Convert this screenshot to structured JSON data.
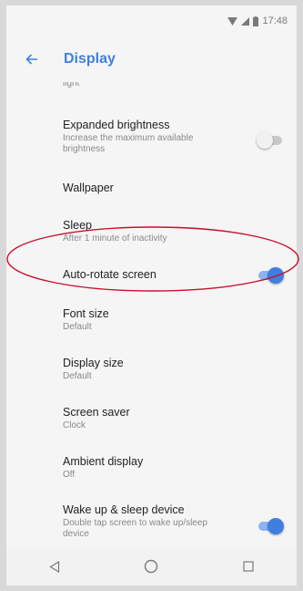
{
  "status_bar": {
    "time": "17:48"
  },
  "app_bar": {
    "title": "Display",
    "back_icon": "arrow-left-icon"
  },
  "settings": [
    {
      "title": "",
      "subtitle": "light"
    },
    {
      "title": "Expanded brightness",
      "subtitle": "Increase the maximum available brightness",
      "toggle": false
    },
    {
      "title": "Wallpaper",
      "subtitle": ""
    },
    {
      "title": "Sleep",
      "subtitle": "After 1 minute of inactivity"
    },
    {
      "title": "Auto-rotate screen",
      "subtitle": "",
      "toggle": true
    },
    {
      "title": "Font size",
      "subtitle": "Default"
    },
    {
      "title": "Display size",
      "subtitle": "Default"
    },
    {
      "title": "Screen saver",
      "subtitle": "Clock"
    },
    {
      "title": "Ambient display",
      "subtitle": "Off"
    },
    {
      "title": "Wake up & sleep device",
      "subtitle": "Double tap screen to wake up/sleep device",
      "toggle": true
    }
  ],
  "nav_bar": {
    "back": "triangle-back-icon",
    "home": "circle-home-icon",
    "recents": "square-recents-icon"
  },
  "colors": {
    "accent": "#3f7fe0",
    "annotation": "#c8102e"
  }
}
